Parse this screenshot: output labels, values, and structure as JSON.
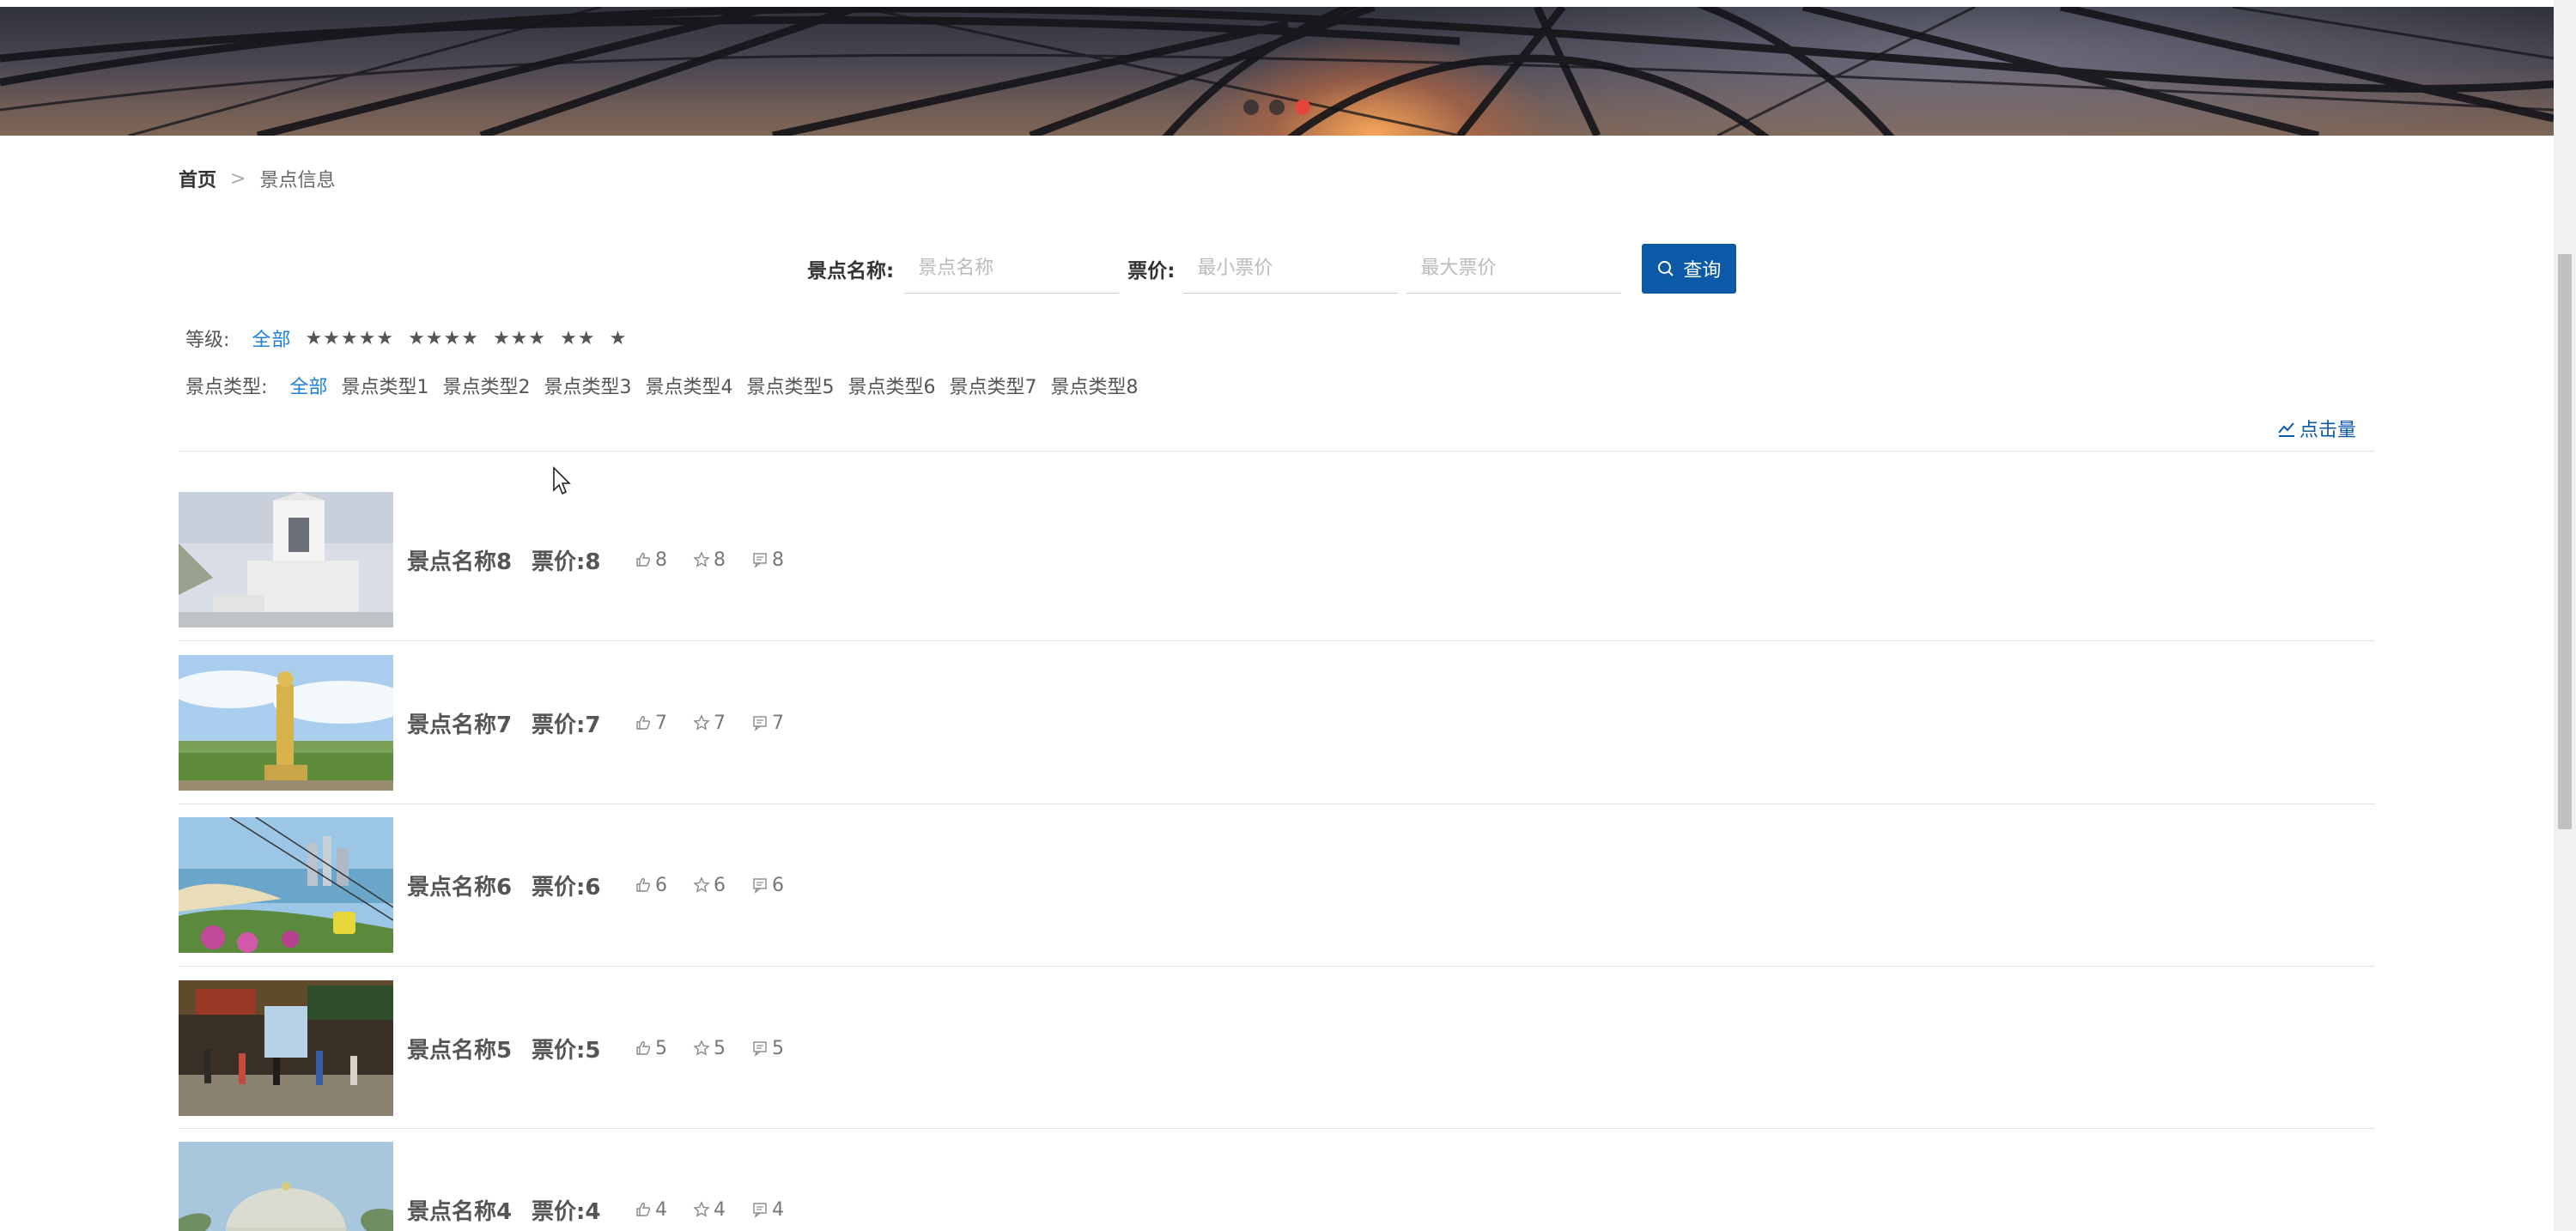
{
  "banner": {
    "dots": [
      {
        "active": false
      },
      {
        "active": false
      },
      {
        "active": true
      }
    ]
  },
  "breadcrumb": {
    "home": "首页",
    "separator": ">",
    "current": "景点信息"
  },
  "search": {
    "name_label": "景点名称:",
    "name_placeholder": "景点名称",
    "price_label": "票价:",
    "min_placeholder": "最小票价",
    "max_placeholder": "最大票价",
    "button_label": "查询"
  },
  "grade_filter": {
    "label": "等级:",
    "options": [
      "全部",
      "★★★★★",
      "★★★★",
      "★★★",
      "★★",
      "★"
    ],
    "selected": "全部"
  },
  "type_filter": {
    "label": "景点类型:",
    "options": [
      "全部",
      "景点类型1",
      "景点类型2",
      "景点类型3",
      "景点类型4",
      "景点类型5",
      "景点类型6",
      "景点类型7",
      "景点类型8"
    ],
    "selected": "全部"
  },
  "sort": {
    "label": "点击量"
  },
  "items": [
    {
      "name": "景点名称8",
      "price": "票价:8",
      "likes": "8",
      "favorites": "8",
      "comments": "8",
      "image": "church"
    },
    {
      "name": "景点名称7",
      "price": "票价:7",
      "likes": "7",
      "favorites": "7",
      "comments": "7",
      "image": "statue"
    },
    {
      "name": "景点名称6",
      "price": "票价:6",
      "likes": "6",
      "favorites": "6",
      "comments": "6",
      "image": "cablecar"
    },
    {
      "name": "景点名称5",
      "price": "票价:5",
      "likes": "5",
      "favorites": "5",
      "comments": "5",
      "image": "crowd"
    },
    {
      "name": "景点名称4",
      "price": "票价:4",
      "likes": "4",
      "favorites": "4",
      "comments": "4",
      "image": "dome"
    }
  ],
  "colors": {
    "primary": "#0c5aa7",
    "active_link": "#1e80d6",
    "dot_active": "#e4463d"
  }
}
